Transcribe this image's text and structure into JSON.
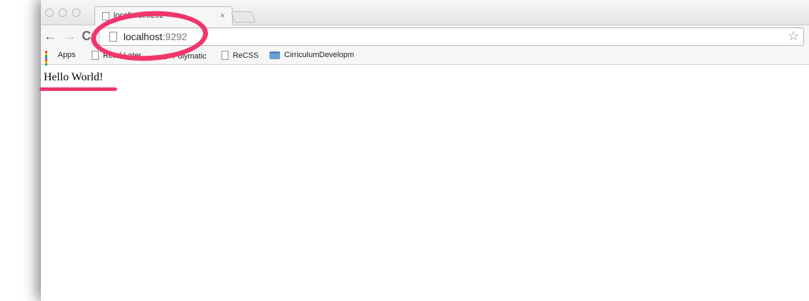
{
  "browser": {
    "tab": {
      "title": "localhost:9292",
      "close_glyph": "×"
    },
    "nav": {
      "back_glyph": "←",
      "forward_glyph": "→",
      "reload_glyph": "C"
    },
    "omnibox": {
      "host": "localhost",
      "port": ":9292",
      "star_glyph": "☆"
    },
    "bookmarks": [
      {
        "label": "Apps",
        "icon": "apps-grid-icon"
      },
      {
        "label": "Read Later",
        "icon": "file-icon"
      },
      {
        "label": "Polymatic",
        "icon": "triangle-icon"
      },
      {
        "label": "ReCSS",
        "icon": "file-icon"
      },
      {
        "label": "CirriculumDevelopm",
        "icon": "folder-icon"
      }
    ]
  },
  "page": {
    "body_text": "Hello World!"
  },
  "colors": {
    "annotation": "#f2356c"
  }
}
